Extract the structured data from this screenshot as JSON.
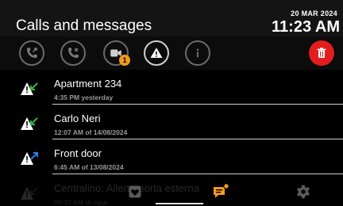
{
  "header": {
    "title": "Calls and messages",
    "date": "20 MAR 2024",
    "time": "11:23 AM"
  },
  "toolbar": {
    "buttons": [
      {
        "icon": "missed-call-icon"
      },
      {
        "icon": "rejected-call-icon"
      },
      {
        "icon": "video-icon",
        "badge": "1"
      },
      {
        "icon": "alert-icon",
        "active": true
      },
      {
        "icon": "info-icon"
      },
      {
        "icon": "trash-icon",
        "color": "#e21d1d"
      }
    ]
  },
  "list": {
    "items": [
      {
        "name": "Apartment 234",
        "time": "4:35 PM yesterday",
        "arrow": "green"
      },
      {
        "name": "Carlo Neri",
        "time": "12:07 AM of 14/08/2024",
        "arrow": "green"
      },
      {
        "name": "Front door",
        "time": "6:45 AM of 13/08/2024",
        "arrow": "blue"
      },
      {
        "name": "Centralino: Allerta porta esterna",
        "time": "08:10 AM di oggi",
        "arrow": "green"
      }
    ]
  },
  "colors": {
    "accent": "#f29a1b",
    "green_arrow": "#34b54a",
    "blue_arrow": "#2f7de1",
    "trash": "#e21d1d"
  },
  "bottom_nav": {
    "items": [
      {
        "icon": "heart-icon"
      },
      {
        "icon": "message-notification-icon",
        "active": true
      },
      {
        "icon": "gear-icon"
      }
    ]
  }
}
